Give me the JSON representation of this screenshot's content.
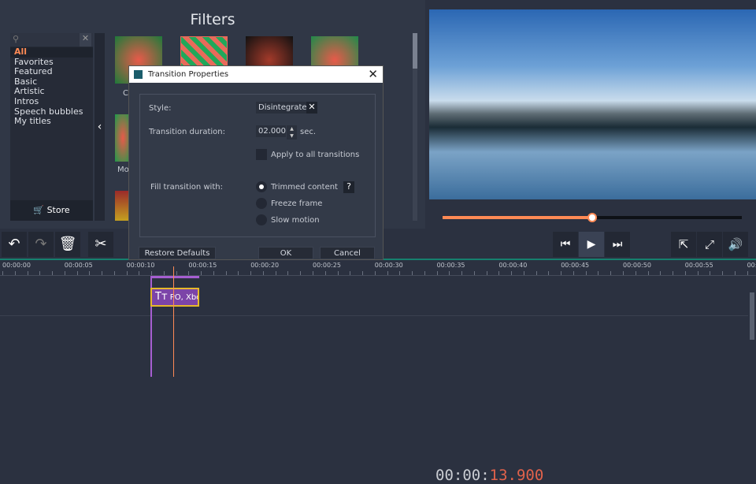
{
  "filters": {
    "title": "Filters",
    "search_placeholder": "",
    "categories": [
      "All",
      "Favorites",
      "Featured",
      "Basic",
      "Artistic",
      "Intros",
      "Speech bubbles",
      "My titles"
    ],
    "store_label": "Store",
    "thumb_labels": [
      "C",
      "Mo"
    ]
  },
  "player": {
    "timecode_prefix": "00:00:",
    "timecode_suffix": "13.900",
    "progress": 0.5
  },
  "toolbar": {
    "undo": "undo-icon",
    "redo": "redo-icon",
    "delete": "trash-icon",
    "cut": "scissors-icon"
  },
  "timeline": {
    "ticks": [
      "00:00:00",
      "00:00:05",
      "00:00:10",
      "00:00:15",
      "00:00:20",
      "00:00:25",
      "00:00:30",
      "00:00:35",
      "00:00:40",
      "00:00:45",
      "00:00:50",
      "00:00:55",
      "00:0"
    ],
    "clip_text": "PO, Xbo",
    "clip_icon": "Tт"
  },
  "dialog": {
    "title": "Transition Properties",
    "style_label": "Style:",
    "style_value": "Disintegrate",
    "duration_label": "Transition duration:",
    "duration_value": "02.000",
    "duration_unit": "sec.",
    "apply_all": "Apply to all transitions",
    "apply_all_checked": false,
    "fill_label": "Fill transition with:",
    "fill_options": [
      "Trimmed content",
      "Freeze frame",
      "Slow motion"
    ],
    "fill_selected": "Trimmed content",
    "help": "?",
    "restore": "Restore Defaults",
    "ok": "OK",
    "cancel": "Cancel"
  },
  "colors": {
    "accent": "#ff8a55",
    "timecode": "#e1624b",
    "clip": "#7c44a8"
  }
}
